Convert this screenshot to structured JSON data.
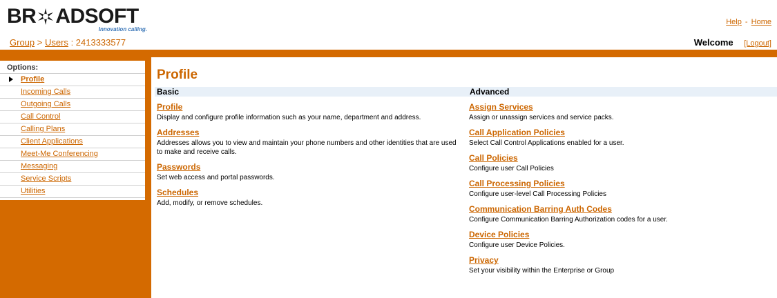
{
  "header": {
    "logo_text": "BROADSOFT",
    "logo_tagline": "Innovation calling.",
    "help_link": "Help",
    "home_link": "Home",
    "link_separator": "-",
    "brand_color": "#d46a00",
    "link_color": "#cc6600"
  },
  "breadcrumb": {
    "group": "Group",
    "separator": ">",
    "users": "Users",
    "user_id": ": 2413333577"
  },
  "user_bar": {
    "welcome": "Welcome",
    "logout": "[Logout]"
  },
  "sidebar": {
    "title": "Options:",
    "items": [
      {
        "label": "Profile",
        "active": true
      },
      {
        "label": "Incoming Calls"
      },
      {
        "label": "Outgoing Calls"
      },
      {
        "label": "Call Control"
      },
      {
        "label": "Calling Plans"
      },
      {
        "label": "Client Applications"
      },
      {
        "label": "Meet-Me Conferencing"
      },
      {
        "label": "Messaging"
      },
      {
        "label": "Service Scripts"
      },
      {
        "label": "Utilities"
      }
    ]
  },
  "main": {
    "title": "Profile",
    "basic": {
      "heading": "Basic",
      "items": [
        {
          "title": "Profile",
          "desc": "Display and configure profile information such as your name, department and address."
        },
        {
          "title": "Addresses",
          "desc": "Addresses allows you to view and maintain your phone numbers and other identities that are used to make and receive calls."
        },
        {
          "title": "Passwords",
          "desc": "Set web access and portal passwords."
        },
        {
          "title": "Schedules",
          "desc": "Add, modify, or remove schedules."
        }
      ]
    },
    "advanced": {
      "heading": "Advanced",
      "items": [
        {
          "title": "Assign Services",
          "desc": "Assign or unassign services and service packs."
        },
        {
          "title": "Call Application Policies",
          "desc": "Select Call Control Applications enabled for a user."
        },
        {
          "title": "Call Policies",
          "desc": "Configure user Call Policies"
        },
        {
          "title": "Call Processing Policies",
          "desc": "Configure user-level Call Processing Policies"
        },
        {
          "title": "Communication Barring Auth Codes",
          "desc": "Configure Communication Barring Authorization codes for a user."
        },
        {
          "title": "Device Policies",
          "desc": "Configure user Device Policies."
        },
        {
          "title": "Privacy",
          "desc": "Set your visibility within the Enterprise or Group"
        }
      ]
    }
  }
}
